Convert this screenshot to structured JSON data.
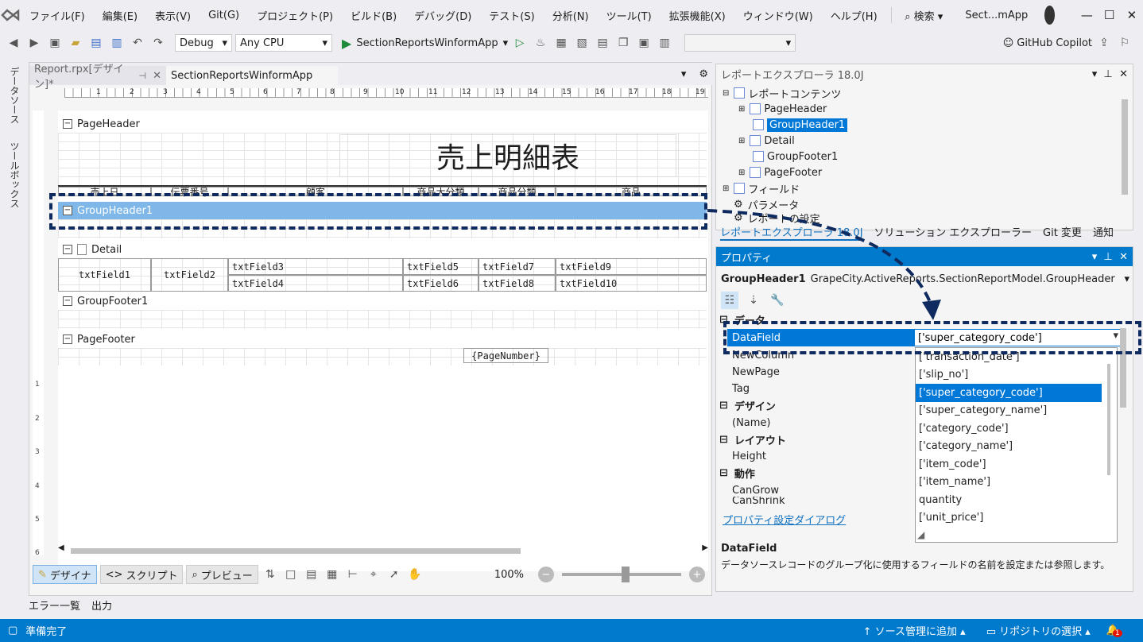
{
  "menubar": {
    "items": [
      "ファイル(F)",
      "編集(E)",
      "表示(V)",
      "Git(G)",
      "プロジェクト(P)",
      "ビルド(B)",
      "デバッグ(D)",
      "テスト(S)",
      "分析(N)",
      "ツール(T)",
      "拡張機能(X)",
      "ウィンドウ(W)",
      "ヘルプ(H)"
    ],
    "search": "検索",
    "solution": "Sect...mApp"
  },
  "toolbar": {
    "config": "Debug",
    "platform": "Any CPU",
    "start": "SectionReportsWinformApp",
    "copilot": "GitHub Copilot"
  },
  "sidetabs": [
    "データソース",
    "ツールボックス"
  ],
  "doc": {
    "tab_active": "Report.rpx[デザイン]*",
    "tab_other": "SectionReportsWinformApp"
  },
  "report": {
    "pageheader": "PageHeader",
    "title": "売上明細表",
    "headers": [
      "売上日",
      "伝票番号",
      "顧客",
      "商品大分類",
      "商品分類",
      "商品"
    ],
    "groupheader": "GroupHeader1",
    "detail": "Detail",
    "groupfooter": "GroupFooter1",
    "pagefooter": "PageFooter",
    "fields": {
      "f1": "txtField1",
      "f2": "txtField2",
      "f3": "txtField3",
      "f4": "txtField4",
      "f5": "txtField5",
      "f6": "txtField6",
      "f7": "txtField7",
      "f8": "txtField8",
      "f9": "txtField9",
      "f10": "txtField10"
    },
    "pagenumber": "{PageNumber}"
  },
  "ruler_v": [
    "1",
    "2",
    "3",
    "4",
    "5",
    "6"
  ],
  "bottombar": {
    "designer": "デザイナ",
    "script": "スクリプト",
    "preview": "プレビュー",
    "zoom": "100%"
  },
  "output_tabs": [
    "エラー一覧",
    "出力"
  ],
  "explorer": {
    "title": "レポートエクスプローラ 18.0J",
    "root": "レポートコンテンツ",
    "nodes": [
      "PageHeader",
      "GroupHeader1",
      "Detail",
      "GroupFooter1",
      "PageFooter"
    ],
    "fields": "フィールド",
    "params": "パラメータ",
    "settings": "レポートの設定",
    "tabs": [
      "レポートエクスプローラ 18.0J",
      "ソリューション エクスプローラー",
      "Git 変更",
      "通知"
    ]
  },
  "properties": {
    "title": "プロパティ",
    "object": "GroupHeader1",
    "object_type": "GrapeCity.ActiveReports.SectionReportModel.GroupHeader",
    "cat_data": "データ",
    "cat_design": "デザイン",
    "cat_layout": "レイアウト",
    "cat_behavior": "動作",
    "rows": {
      "datafield": "DataField",
      "newcolumn": "NewColumn",
      "newpage": "NewPage",
      "tag": "Tag",
      "name": "(Name)",
      "height": "Height",
      "cangrow": "CanGrow",
      "canshrink": "CanShrink"
    },
    "datafield_value": "['super_category_code']",
    "link": "プロパティ設定ダイアログ",
    "desc_title": "DataField",
    "desc": "データソースレコードのグループ化に使用するフィールドの名前を設定または参照します。"
  },
  "dropdown": [
    "['transaction_date']",
    "['slip_no']",
    "['super_category_code']",
    "['super_category_name']",
    "['category_code']",
    "['category_name']",
    "['item_code']",
    "['item_name']",
    "quantity",
    "['unit_price']"
  ],
  "status": {
    "ready": "準備完了",
    "source": "ソース管理に追加",
    "repo": "リポジトリの選択",
    "badge": "1"
  },
  "colors": {
    "accent": "#007acc",
    "selection": "#0078d7",
    "highlight_band": "#7fb8e8",
    "dash": "#0e2a5e"
  }
}
